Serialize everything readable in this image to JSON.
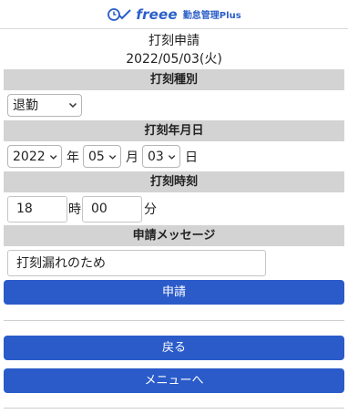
{
  "header": {
    "brand": "freee",
    "product": "勤怠管理Plus",
    "logo_icon": "clock-check-icon"
  },
  "page": {
    "title": "打刻申請",
    "date": "2022/05/03(火)"
  },
  "stamp_type": {
    "label": "打刻種別",
    "selected": "退勤"
  },
  "stamp_date": {
    "label": "打刻年月日",
    "year": "2022",
    "year_unit": "年",
    "month": "05",
    "month_unit": "月",
    "day": "03",
    "day_unit": "日"
  },
  "stamp_time": {
    "label": "打刻時刻",
    "hour": "18",
    "hour_unit": "時",
    "minute": "00",
    "minute_unit": "分"
  },
  "message": {
    "label": "申請メッセージ",
    "value": "打刻漏れのため"
  },
  "buttons": {
    "submit": "申請",
    "back": "戻る",
    "menu": "メニューへ"
  },
  "colors": {
    "accent": "#2a5bc9",
    "section_bg": "#d3d3d3"
  }
}
